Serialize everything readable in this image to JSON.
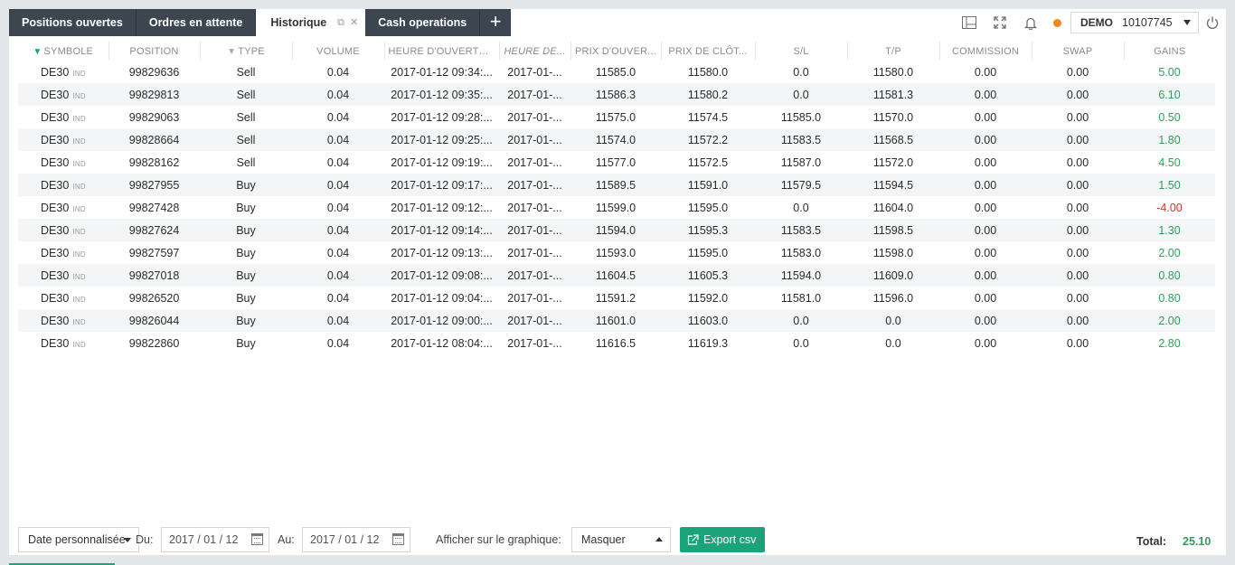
{
  "tabs": [
    {
      "label": "Positions ouvertes"
    },
    {
      "label": "Ordres en attente"
    },
    {
      "label": "Historique"
    },
    {
      "label": "Cash operations"
    }
  ],
  "tab_add_label": "+",
  "account": {
    "mode": "DEMO",
    "number": "10107745"
  },
  "columns": [
    "SYMBOLE",
    "POSITION",
    "TYPE",
    "VOLUME",
    "HEURE D'OUVERTURE",
    "HEURE DE...",
    "PRIX D'OUVER...",
    "PRIX DE CLÔT...",
    "S/L",
    "T/P",
    "COMMISSION",
    "SWAP",
    "GAINS"
  ],
  "symbol_tag": "IND",
  "rows": [
    {
      "symbol": "DE30",
      "position": "99829636",
      "type": "Sell",
      "volume": "0.04",
      "open_time": "2017-01-12 09:34:...",
      "close_time": "2017-01-...",
      "open_price": "11585.0",
      "close_price": "11580.0",
      "sl": "0.0",
      "tp": "11580.0",
      "commission": "0.00",
      "swap": "0.00",
      "gain": "5.00"
    },
    {
      "symbol": "DE30",
      "position": "99829813",
      "type": "Sell",
      "volume": "0.04",
      "open_time": "2017-01-12 09:35:...",
      "close_time": "2017-01-...",
      "open_price": "11586.3",
      "close_price": "11580.2",
      "sl": "0.0",
      "tp": "11581.3",
      "commission": "0.00",
      "swap": "0.00",
      "gain": "6.10"
    },
    {
      "symbol": "DE30",
      "position": "99829063",
      "type": "Sell",
      "volume": "0.04",
      "open_time": "2017-01-12 09:28:...",
      "close_time": "2017-01-...",
      "open_price": "11575.0",
      "close_price": "11574.5",
      "sl": "11585.0",
      "tp": "11570.0",
      "commission": "0.00",
      "swap": "0.00",
      "gain": "0.50"
    },
    {
      "symbol": "DE30",
      "position": "99828664",
      "type": "Sell",
      "volume": "0.04",
      "open_time": "2017-01-12 09:25:...",
      "close_time": "2017-01-...",
      "open_price": "11574.0",
      "close_price": "11572.2",
      "sl": "11583.5",
      "tp": "11568.5",
      "commission": "0.00",
      "swap": "0.00",
      "gain": "1.80"
    },
    {
      "symbol": "DE30",
      "position": "99828162",
      "type": "Sell",
      "volume": "0.04",
      "open_time": "2017-01-12 09:19:...",
      "close_time": "2017-01-...",
      "open_price": "11577.0",
      "close_price": "11572.5",
      "sl": "11587.0",
      "tp": "11572.0",
      "commission": "0.00",
      "swap": "0.00",
      "gain": "4.50"
    },
    {
      "symbol": "DE30",
      "position": "99827955",
      "type": "Buy",
      "volume": "0.04",
      "open_time": "2017-01-12 09:17:...",
      "close_time": "2017-01-...",
      "open_price": "11589.5",
      "close_price": "11591.0",
      "sl": "11579.5",
      "tp": "11594.5",
      "commission": "0.00",
      "swap": "0.00",
      "gain": "1.50"
    },
    {
      "symbol": "DE30",
      "position": "99827428",
      "type": "Buy",
      "volume": "0.04",
      "open_time": "2017-01-12 09:12:...",
      "close_time": "2017-01-...",
      "open_price": "11599.0",
      "close_price": "11595.0",
      "sl": "0.0",
      "tp": "11604.0",
      "commission": "0.00",
      "swap": "0.00",
      "gain": "-4.00"
    },
    {
      "symbol": "DE30",
      "position": "99827624",
      "type": "Buy",
      "volume": "0.04",
      "open_time": "2017-01-12 09:14:...",
      "close_time": "2017-01-...",
      "open_price": "11594.0",
      "close_price": "11595.3",
      "sl": "11583.5",
      "tp": "11598.5",
      "commission": "0.00",
      "swap": "0.00",
      "gain": "1.30"
    },
    {
      "symbol": "DE30",
      "position": "99827597",
      "type": "Buy",
      "volume": "0.04",
      "open_time": "2017-01-12 09:13:...",
      "close_time": "2017-01-...",
      "open_price": "11593.0",
      "close_price": "11595.0",
      "sl": "11583.0",
      "tp": "11598.0",
      "commission": "0.00",
      "swap": "0.00",
      "gain": "2.00"
    },
    {
      "symbol": "DE30",
      "position": "99827018",
      "type": "Buy",
      "volume": "0.04",
      "open_time": "2017-01-12 09:08:...",
      "close_time": "2017-01-...",
      "open_price": "11604.5",
      "close_price": "11605.3",
      "sl": "11594.0",
      "tp": "11609.0",
      "commission": "0.00",
      "swap": "0.00",
      "gain": "0.80"
    },
    {
      "symbol": "DE30",
      "position": "99826520",
      "type": "Buy",
      "volume": "0.04",
      "open_time": "2017-01-12 09:04:...",
      "close_time": "2017-01-...",
      "open_price": "11591.2",
      "close_price": "11592.0",
      "sl": "11581.0",
      "tp": "11596.0",
      "commission": "0.00",
      "swap": "0.00",
      "gain": "0.80"
    },
    {
      "symbol": "DE30",
      "position": "99826044",
      "type": "Buy",
      "volume": "0.04",
      "open_time": "2017-01-12 09:00:...",
      "close_time": "2017-01-...",
      "open_price": "11601.0",
      "close_price": "11603.0",
      "sl": "0.0",
      "tp": "0.0",
      "commission": "0.00",
      "swap": "0.00",
      "gain": "2.00"
    },
    {
      "symbol": "DE30",
      "position": "99822860",
      "type": "Buy",
      "volume": "0.04",
      "open_time": "2017-01-12 08:04:...",
      "close_time": "2017-01-...",
      "open_price": "11616.5",
      "close_price": "11619.3",
      "sl": "0.0",
      "tp": "0.0",
      "commission": "0.00",
      "swap": "0.00",
      "gain": "2.80"
    }
  ],
  "footer": {
    "period_select": "Date personnalisée",
    "from_label": "Du:",
    "from_value": "2017 / 01 / 12",
    "to_label": "Au:",
    "to_value": "2017 / 01 / 12",
    "chart_label": "Afficher sur le graphique:",
    "chart_select": "Masquer",
    "export_label": "Export csv",
    "total_label": "Total:",
    "total_value": "25.10"
  },
  "colors": {
    "tab_dark": "#3c4650",
    "positive": "#2f9e5c",
    "negative": "#d9342b",
    "accent": "#1ba37a",
    "status_dot": "#f08a1c"
  },
  "icons": [
    "layout-icon",
    "fullscreen-icon",
    "bell-icon",
    "power-icon",
    "popout-icon",
    "close-icon",
    "filter-icon",
    "calendar-icon",
    "export-icon"
  ]
}
